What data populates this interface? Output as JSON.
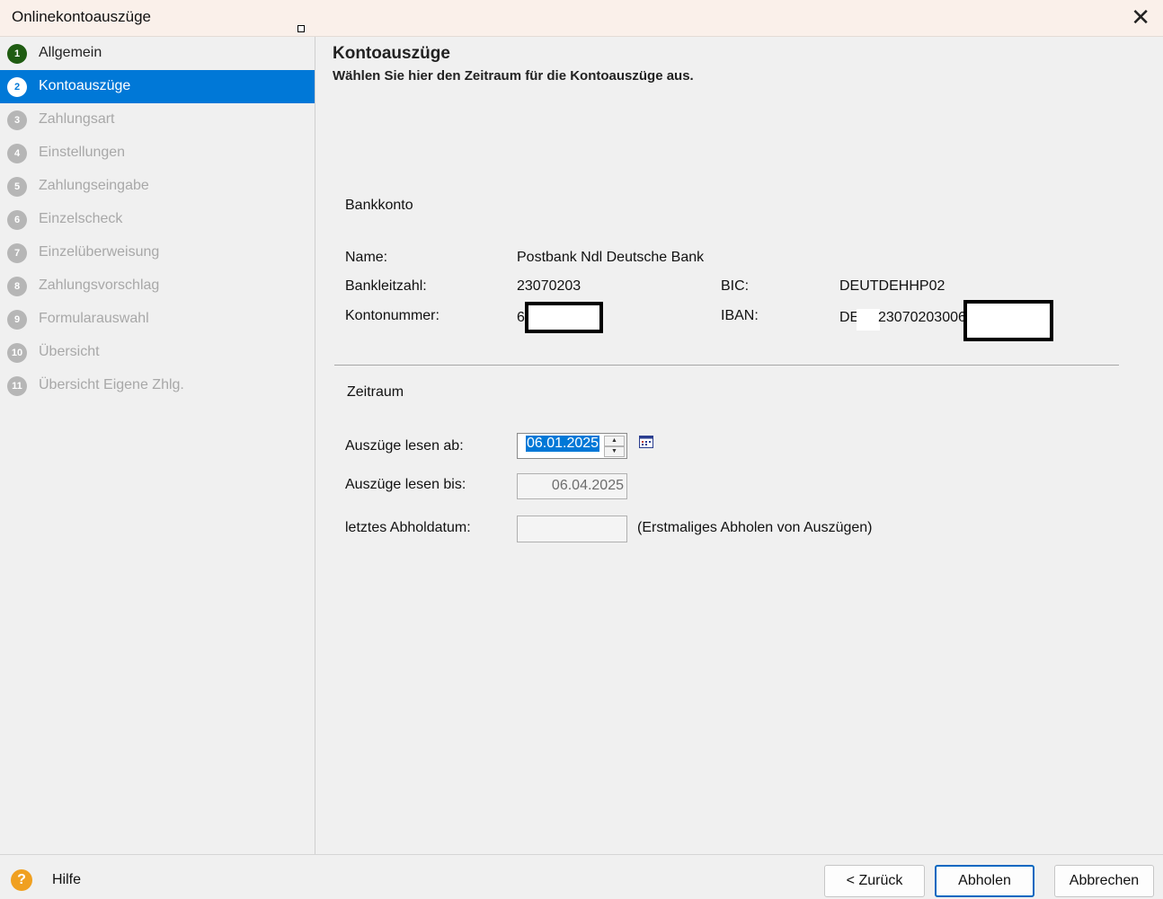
{
  "window": {
    "title": "Onlinekontoauszüge",
    "close_label": "✕"
  },
  "sidebar": {
    "steps": [
      {
        "num": "1",
        "label": "Allgemein",
        "state": "done"
      },
      {
        "num": "2",
        "label": "Kontoauszüge",
        "state": "active"
      },
      {
        "num": "3",
        "label": "Zahlungsart",
        "state": "disabled"
      },
      {
        "num": "4",
        "label": "Einstellungen",
        "state": "disabled"
      },
      {
        "num": "5",
        "label": "Zahlungseingabe",
        "state": "disabled"
      },
      {
        "num": "6",
        "label": "Einzelscheck",
        "state": "disabled"
      },
      {
        "num": "7",
        "label": "Einzelüberweisung",
        "state": "disabled"
      },
      {
        "num": "8",
        "label": "Zahlungsvorschlag",
        "state": "disabled"
      },
      {
        "num": "9",
        "label": "Formularauswahl",
        "state": "disabled"
      },
      {
        "num": "10",
        "label": "Übersicht",
        "state": "disabled"
      },
      {
        "num": "11",
        "label": "Übersicht Eigene Zhlg.",
        "state": "disabled"
      }
    ]
  },
  "main": {
    "title": "Kontoauszüge",
    "subtitle": "Wählen Sie hier den Zeitraum für die Kontoauszüge aus.",
    "bank_section": "Bankkonto",
    "name_label": "Name:",
    "name_value": "Postbank Ndl Deutsche Bank",
    "blz_label": "Bankleitzahl:",
    "blz_value": "23070203",
    "bic_label": "BIC:",
    "bic_value": "DEUTDEHHP02",
    "konto_label": "Kontonummer:",
    "konto_value": "6",
    "iban_label": "IBAN:",
    "iban_prefix": "DE",
    "iban_value": "23070203006",
    "period_section": "Zeitraum",
    "from_label": "Auszüge lesen ab:",
    "from_value": "06.01.2025",
    "to_label": "Auszüge lesen bis:",
    "to_value": "06.04.2025",
    "last_label": "letztes Abholdatum:",
    "last_value": "",
    "last_note": "(Erstmaliges Abholen von Auszügen)"
  },
  "footer": {
    "help_label": "Hilfe",
    "back_label": "< Zurück",
    "fetch_label": "Abholen",
    "cancel_label": "Abbrechen"
  },
  "colors": {
    "accent": "#0078d7",
    "done_step": "#1f5c12",
    "help": "#f0a020"
  }
}
